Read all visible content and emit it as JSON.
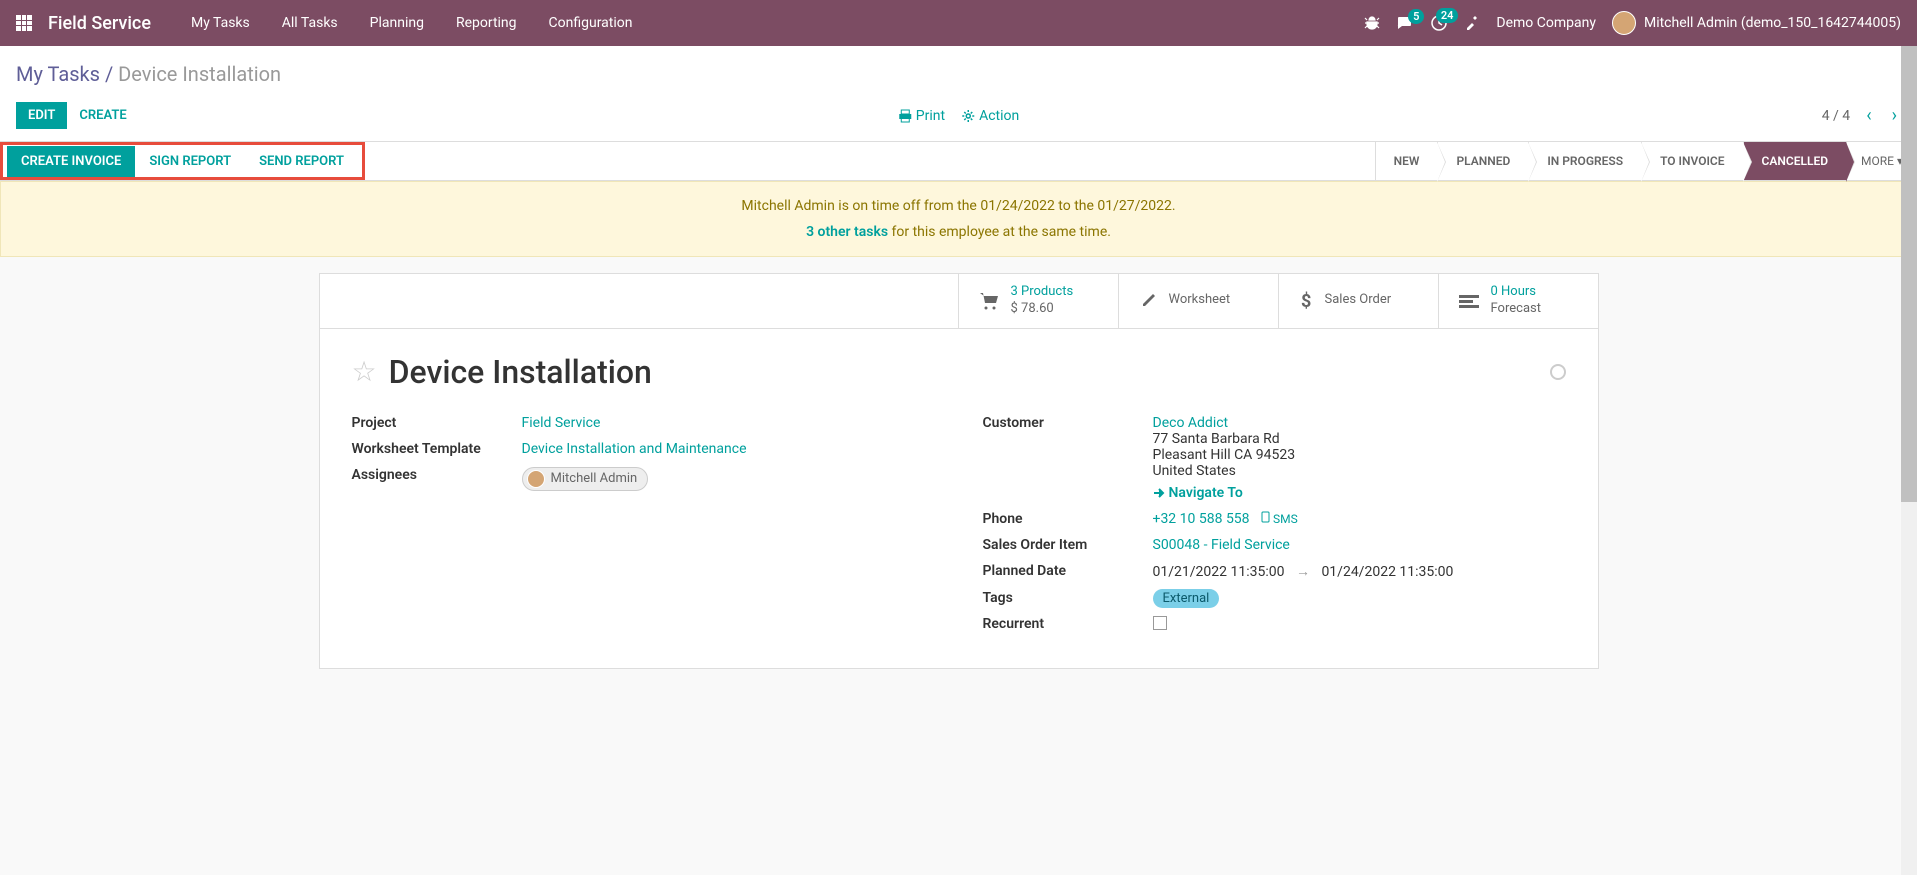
{
  "topbar": {
    "app_name": "Field Service",
    "menu": [
      "My Tasks",
      "All Tasks",
      "Planning",
      "Reporting",
      "Configuration"
    ],
    "msg_badge": "5",
    "activity_badge": "24",
    "company": "Demo Company",
    "user": "Mitchell Admin (demo_150_1642744005)"
  },
  "breadcrumb": {
    "parent": "My Tasks",
    "current": "Device Installation"
  },
  "actions": {
    "edit": "Edit",
    "create": "Create",
    "print": "Print",
    "action": "Action",
    "pager": "4 / 4"
  },
  "strip": {
    "create_invoice": "Create Invoice",
    "sign_report": "Sign Report",
    "send_report": "Send Report"
  },
  "statuses": [
    "NEW",
    "PLANNED",
    "IN PROGRESS",
    "TO INVOICE",
    "CANCELLED"
  ],
  "status_more": "MORE",
  "alert": {
    "line1_a": "Mitchell Admin is on time off from the 01/24/2022 to the 01/27/2022.",
    "other_tasks": "3 other tasks",
    "line2_b": " for this employee at the same time."
  },
  "stats": {
    "products_l1": "3  Products",
    "products_l2": "$ 78.60",
    "worksheet": "Worksheet",
    "sales_order": "Sales Order",
    "hours_l1": "0  Hours",
    "hours_l2": "Forecast"
  },
  "task": {
    "title": "Device Installation",
    "labels": {
      "project": "Project",
      "worksheet_template": "Worksheet Template",
      "assignees": "Assignees",
      "customer": "Customer",
      "phone": "Phone",
      "sales_order_item": "Sales Order Item",
      "planned_date": "Planned Date",
      "tags": "Tags",
      "recurrent": "Recurrent"
    },
    "project": "Field Service",
    "worksheet_template": "Device Installation and Maintenance",
    "assignee": "Mitchell Admin",
    "customer_name": "Deco Addict",
    "customer_addr1": "77 Santa Barbara Rd",
    "customer_addr2": "Pleasant Hill CA 94523",
    "customer_country": "United States",
    "navigate": "Navigate To",
    "phone": "+32 10 588 558",
    "sms": "SMS",
    "so_item": "S00048 - Field Service",
    "date_from": "01/21/2022 11:35:00",
    "date_to": "01/24/2022 11:35:00",
    "tag": "External"
  }
}
